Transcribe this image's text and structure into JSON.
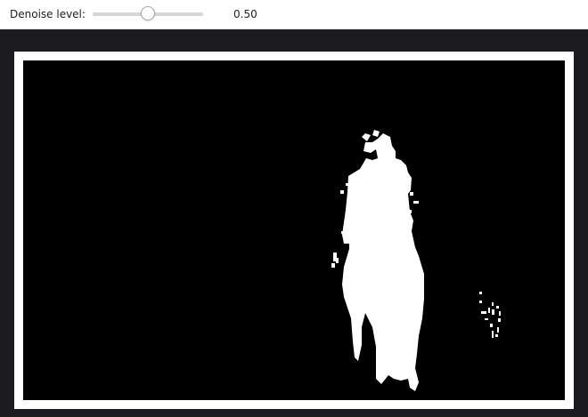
{
  "toolbar": {
    "label": "Denoise level:",
    "value_text": "0.50",
    "slider": {
      "min": 0,
      "max": 1,
      "value": 0.5
    }
  },
  "image": {
    "mask_foreground_color": "#ffffff",
    "mask_background_color": "#000000"
  }
}
